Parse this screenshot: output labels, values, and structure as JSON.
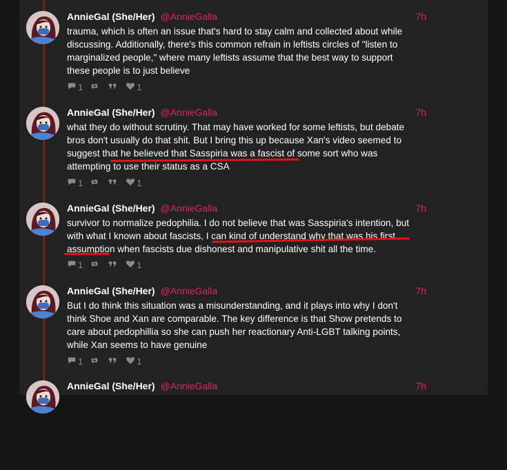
{
  "tweets": [
    {
      "name": "AnnieGal (She/Her)",
      "handle": "@AnnieGalla",
      "time": "7h",
      "lines": [
        "trauma, which is often an issue that's hard to stay calm and collected about while",
        "discussing. Additionally, there's this common refrain in leftists circles of \"listen to",
        "marginalized people,\" where many leftists assume that the best way to support",
        "these people is to just believe"
      ],
      "replies": "1",
      "retweets": "",
      "likes": "1"
    },
    {
      "name": "AnnieGal (She/Her)",
      "handle": "@AnnieGalla",
      "time": "7h",
      "lines": [
        "what they do without scrutiny. That may have worked for some leftists, but debate",
        "bros don't usually do that shit. But I bring this up because Xan's video seemed to",
        "suggest that he believed that Sasspiria was a fascist of some sort who was",
        "attempting to use their status as a CSA"
      ],
      "replies": "1",
      "retweets": "",
      "likes": "1"
    },
    {
      "name": "AnnieGal (She/Her)",
      "handle": "@AnnieGalla",
      "time": "7h",
      "lines": [
        "survivor to normalize pedophilia. I do not believe that was Sasspiria's intention, but",
        "with what I known about fascists, I can kind of understand why that was his first",
        "assumption when fascists due dishonest and manipulative shit all the time."
      ],
      "replies": "1",
      "retweets": "",
      "likes": "1"
    },
    {
      "name": "AnnieGal (She/Her)",
      "handle": "@AnnieGalla",
      "time": "7h",
      "lines": [
        "But I do think this situation was a misunderstanding, and it plays into why I don't",
        "think Shoe and Xan are comparable. The key difference is that Show pretends to",
        "care about pedophillia so she can push her reactionary Anti-LGBT talking points,",
        "while Xan seems to have genuine"
      ],
      "replies": "1",
      "retweets": "",
      "likes": "1"
    },
    {
      "name": "AnnieGal (She/Her)",
      "handle": "@AnnieGalla",
      "time": "7h",
      "lines": [],
      "replies": "",
      "retweets": "",
      "likes": ""
    }
  ],
  "colors": {
    "accent": "#e0245e",
    "underline": "#e8101c",
    "thread_line": "#5a2b2b"
  },
  "icons": [
    "reply-icon",
    "retweet-icon",
    "quote-icon",
    "like-icon"
  ]
}
